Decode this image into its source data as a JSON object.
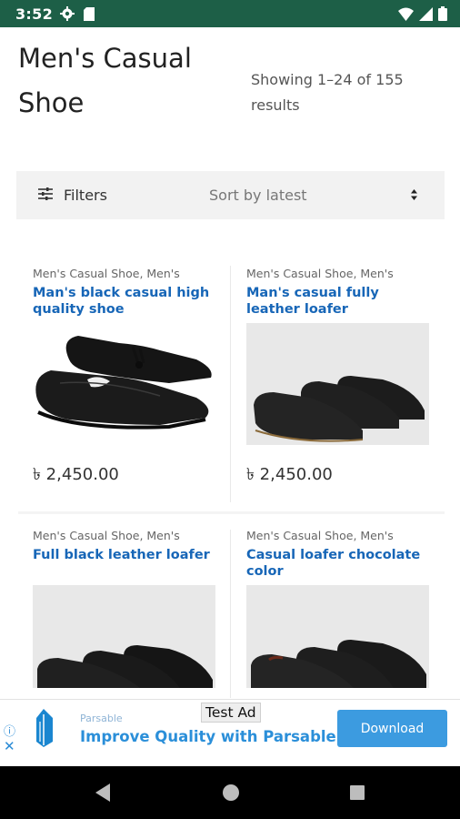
{
  "status_bar": {
    "time": "3:52",
    "left_icons": [
      "gear-icon",
      "sd-card-icon"
    ],
    "right_icons": [
      "wifi-icon",
      "signal-icon",
      "battery-icon"
    ]
  },
  "page": {
    "title": "Men's Casual Shoe",
    "results": "Showing 1–24 of 155 results"
  },
  "toolbar": {
    "filters_label": "Filters",
    "sort_value": "Sort by latest"
  },
  "products": [
    {
      "category": "Men's Casual Shoe, Men's",
      "title": "Man's black casual high quality shoe",
      "price": "৳ 2,450.00"
    },
    {
      "category": "Men's Casual Shoe, Men's",
      "title": "Man's casual fully leather loafer",
      "price": "৳ 2,450.00"
    },
    {
      "category": "Men's Casual Shoe, Men's",
      "title": "Full black leather loafer",
      "price": ""
    },
    {
      "category": "Men's Casual Shoe, Men's",
      "title": "Casual loafer chocolate color",
      "price": ""
    }
  ],
  "ad": {
    "label": "Test Ad",
    "brand": "Parsable",
    "headline": "Improve Quality with Parsable",
    "button": "Download"
  },
  "colors": {
    "status_bar": "#1d5f47",
    "link_blue": "#1766b7",
    "ad_blue": "#3c9be0"
  }
}
